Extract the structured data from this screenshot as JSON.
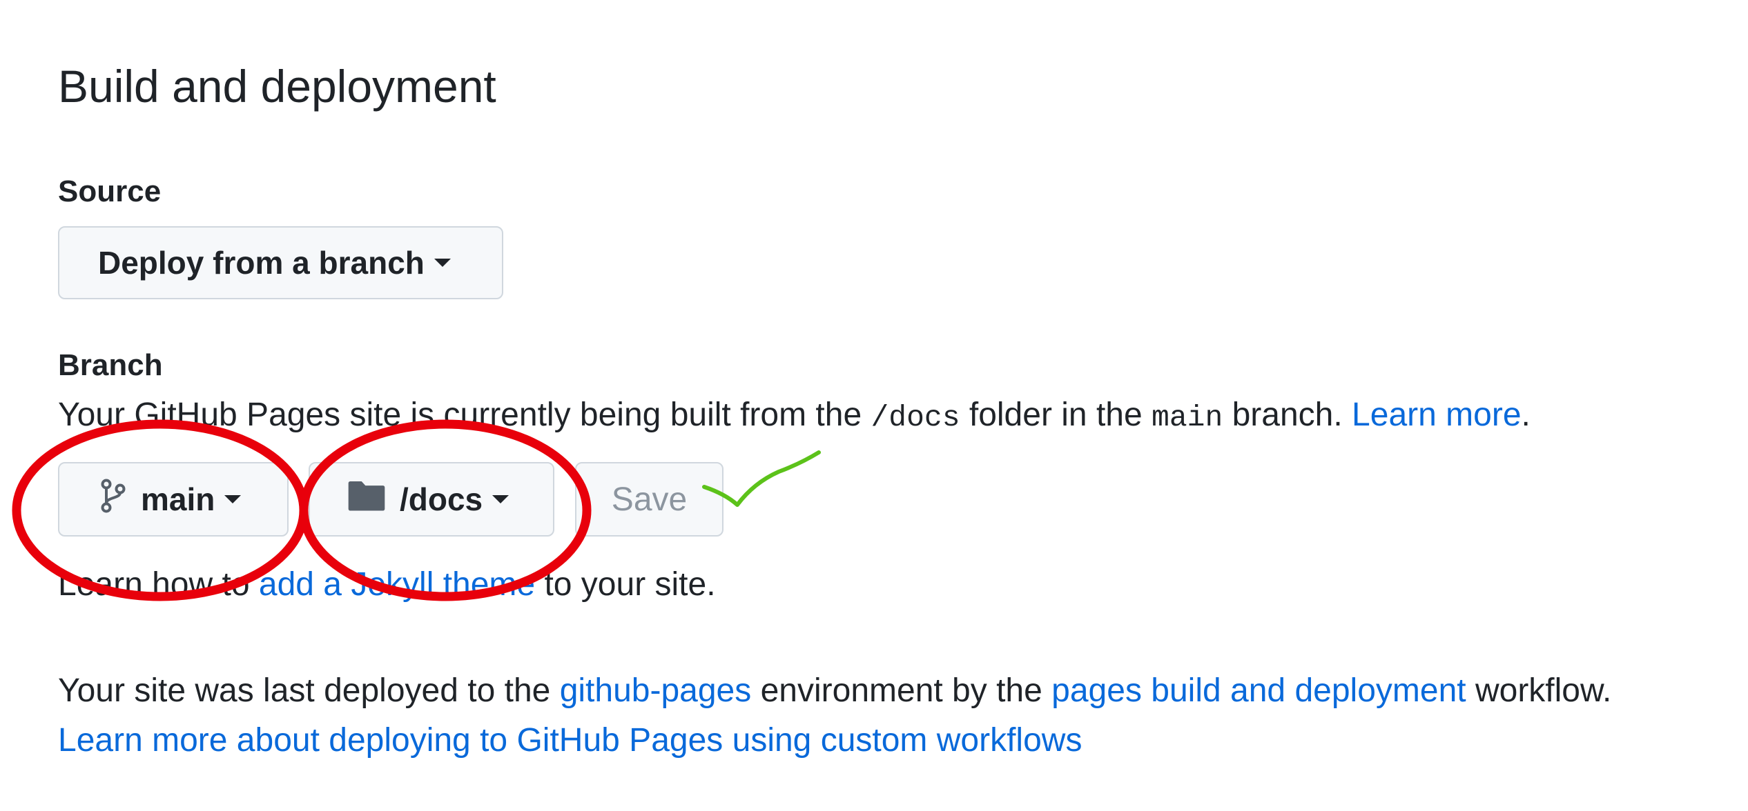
{
  "section": {
    "title": "Build and deployment"
  },
  "source": {
    "label": "Source",
    "dropdown_value": "Deploy from a branch"
  },
  "branch": {
    "label": "Branch",
    "description_prefix": "Your GitHub Pages site is currently being built from the",
    "folder_code": "/docs",
    "description_middle": "folder in the",
    "branch_code": "main",
    "description_suffix": "branch.",
    "learn_more": "Learn more",
    "learn_more_period": ".",
    "branch_value": "main",
    "folder_value": "/docs",
    "save_label": "Save",
    "branch_icon": "git-branch-icon",
    "folder_icon": "folder-icon"
  },
  "theme": {
    "prefix": "Learn how to",
    "link": "add a Jekyll theme",
    "suffix": "to your site."
  },
  "deployment": {
    "text1": "Your site was last deployed to the",
    "env_link": "github-pages",
    "text2": "environment by the",
    "workflow_link": "pages build and deployment",
    "text3": "workflow.",
    "custom_link": "Learn more about deploying to GitHub Pages using custom workflows"
  },
  "annotations": {
    "circle_color": "#e8000b",
    "check_color": "#5cc21a"
  },
  "colors": {
    "link": "#0969da",
    "button_bg": "#f6f8fa",
    "button_border": "#d0d7de",
    "text": "#1f2328",
    "disabled_text": "#8c959f"
  }
}
